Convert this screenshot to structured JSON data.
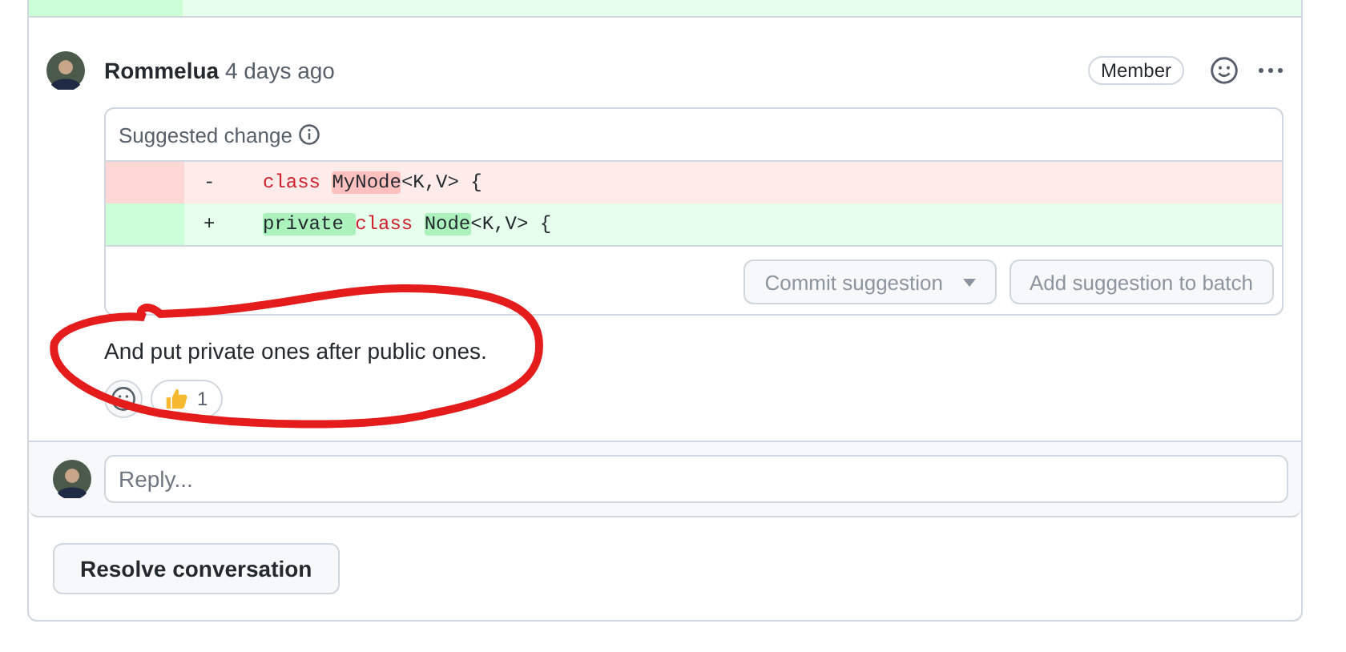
{
  "comment": {
    "author": "Rommelua",
    "time": "4 days ago",
    "role_badge": "Member",
    "suggestion": {
      "title": "Suggested change",
      "lines": [
        {
          "kind": "deletion",
          "marker": "-",
          "segments": [
            {
              "text": "class ",
              "kind": "keyword",
              "changed": false
            },
            {
              "text": "MyNode",
              "kind": "plain",
              "changed": true
            },
            {
              "text": "<K,V> {",
              "kind": "plain",
              "changed": false
            }
          ]
        },
        {
          "kind": "addition",
          "marker": "+",
          "segments": [
            {
              "text": "private ",
              "kind": "plain",
              "changed": true
            },
            {
              "text": "class ",
              "kind": "keyword",
              "changed": false
            },
            {
              "text": "Node",
              "kind": "plain",
              "changed": true
            },
            {
              "text": "<K,V> {",
              "kind": "plain",
              "changed": false
            }
          ]
        }
      ],
      "buttons": [
        {
          "label": "Commit suggestion",
          "kind": "dropdown",
          "disabled": true
        },
        {
          "label": "Add suggestion to batch",
          "kind": "plain",
          "disabled": true
        }
      ]
    },
    "body": "And put private ones after public ones.",
    "reactions": [
      {
        "count": "1"
      }
    ]
  },
  "reply": {
    "placeholder": "Reply..."
  },
  "resolve_button": "Resolve conversation"
}
